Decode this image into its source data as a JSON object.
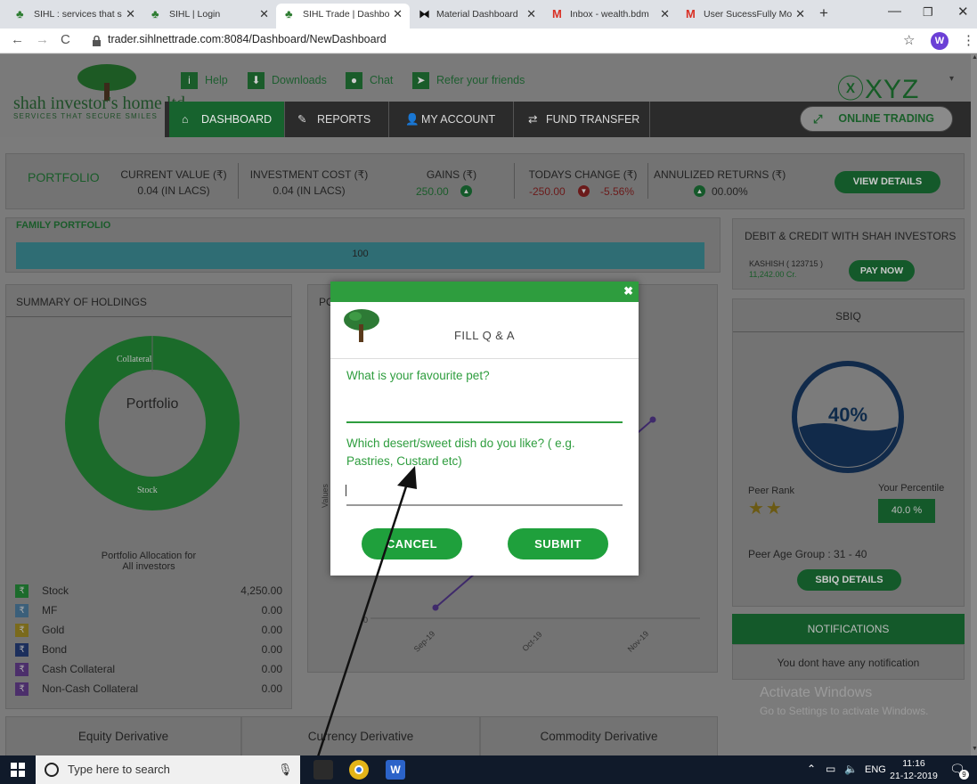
{
  "browser": {
    "tabs": [
      {
        "label": "SIHL : services that s",
        "active": false
      },
      {
        "label": "SIHL | Login",
        "active": false
      },
      {
        "label": "SIHL Trade | Dashbo",
        "active": true
      },
      {
        "label": "Material Dashboard",
        "active": false
      },
      {
        "label": "Inbox - wealth.bdm",
        "active": false
      },
      {
        "label": "User SucessFully Mo",
        "active": false
      }
    ],
    "new_tab": "+",
    "url": "trader.sihlnettrade.com:8084/Dashboard/NewDashboard",
    "profile_initial": "W"
  },
  "header": {
    "top_links": [
      "Help",
      "Downloads",
      "Chat",
      "Refer your friends"
    ],
    "logo_text": "shah investor's home ltd",
    "logo_tagline": "SERVICES THAT SECURE SMILES",
    "brand": "ⓧXYZ",
    "nav": [
      "DASHBOARD",
      "REPORTS",
      "MY ACCOUNT",
      "FUND TRANSFER"
    ],
    "online_trading": "ONLINE TRADING"
  },
  "portfolio": {
    "label": "PORTFOLIO",
    "current_value_label": "CURRENT VALUE (₹)",
    "current_value": "0.04 (IN LACS)",
    "investment_cost_label": "INVESTMENT COST (₹)",
    "investment_cost": "0.04 (IN LACS)",
    "gains_label": "GAINS (₹)",
    "gains": "250.00",
    "todays_change_label": "TODAYS CHANGE (₹)",
    "todays_change": "-250.00",
    "todays_change_pct": "-5.56%",
    "annualized_label": "ANNULIZED RETURNS (₹)",
    "annualized": "00.00%",
    "view_details": "VIEW DETAILS"
  },
  "family": {
    "label": "FAMILY PORTFOLIO",
    "bar_value": "100"
  },
  "debit_credit": {
    "title": "DEBIT & CREDIT WITH SHAH INVESTORS",
    "account": "KASHISH ( 123715 )",
    "amount": "11,242.00 Cr.",
    "pay_now": "PAY NOW"
  },
  "holdings": {
    "title": "SUMMARY OF HOLDINGS",
    "donut_center": "Portfolio",
    "donut_label_top": "Collateral",
    "donut_label_bottom": "Stock",
    "caption_line1": "Portfolio Allocation for",
    "caption_line2": "All investors",
    "rows": [
      {
        "name": "Stock",
        "value": "4,250.00",
        "color": "#1c6b2c"
      },
      {
        "name": "MF",
        "value": "0.00",
        "color": "#3b5f7a"
      },
      {
        "name": "Gold",
        "value": "0.00",
        "color": "#7a6a1c"
      },
      {
        "name": "Bond",
        "value": "0.00",
        "color": "#1c2f5c"
      },
      {
        "name": "Cash Collateral",
        "value": "0.00",
        "color": "#4c2f6b"
      },
      {
        "name": "Non-Cash Collateral",
        "value": "0.00",
        "color": "#4c2f6b"
      }
    ],
    "rupee": "₹"
  },
  "perf_chart": {
    "title_stub": "PO",
    "ylabel": "Values",
    "x_ticks": [
      "Sep-19",
      "Oct-19",
      "Nov-19"
    ],
    "y_zero": "0"
  },
  "sbiq": {
    "title": "SBIQ",
    "gauge": "40%",
    "gauge_fraction": 0.4,
    "peer_rank_label": "Peer Rank",
    "stars": "★★",
    "percentile_label": "Your Percentile",
    "percentile": "40.0 %",
    "peer_age": "Peer Age Group : 31 - 40",
    "details": "SBIQ DETAILS"
  },
  "notifications": {
    "title": "NOTIFICATIONS",
    "message": "You dont have any notification"
  },
  "watermark": {
    "line1": "Activate Windows",
    "line2": "Go to Settings to activate Windows."
  },
  "bottom_tabs": [
    "Equity Derivative",
    "Currency Derivative",
    "Commodity Derivative"
  ],
  "dialog": {
    "close": "✖",
    "title": "FILL Q & A",
    "q1": "What is your favourite pet?",
    "q1_value": "",
    "q2": "Which desert/sweet dish do you like? ( e.g. Pastries, Custard etc)",
    "q2_value": "",
    "cancel": "CANCEL",
    "submit": "SUBMIT"
  },
  "taskbar": {
    "search_placeholder": "Type here to search",
    "lang": "ENG",
    "time": "11:16",
    "date": "21-12-2019",
    "notif_count": "9"
  }
}
